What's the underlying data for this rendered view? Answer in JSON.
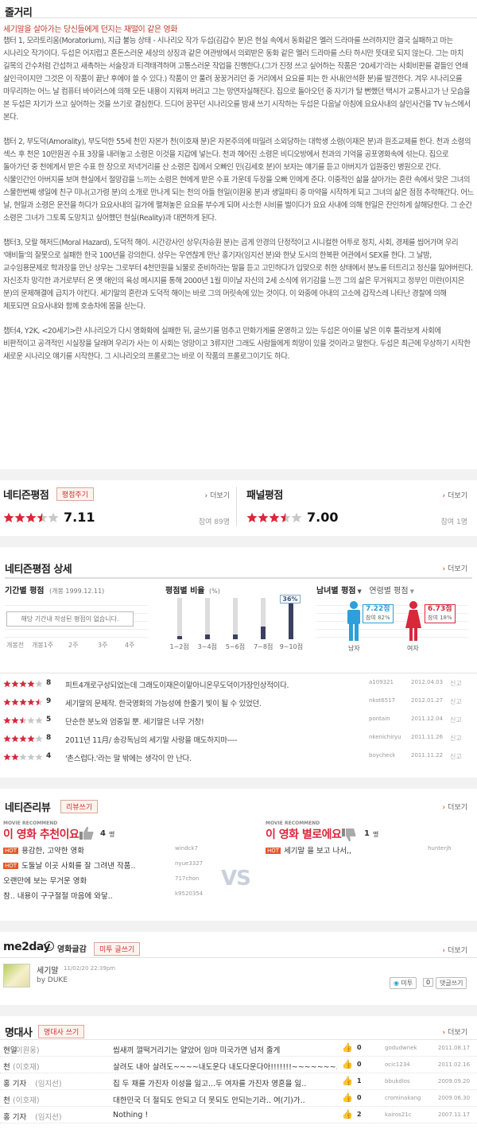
{
  "synopsis": {
    "title": "줄거리",
    "tagline": "세기말을 살아가는 당신들에게 던지는 재떨이 같은 영화",
    "paragraphs": [
      "챕터 1, 모라토리움(Moratorium), 지급 불능 상태 - 시나리오 작가 두섭(김갑수 분)은 현실 속에서 동화같은 멜러 드라마를 쓰려하지만 결국 실패하고 마는 시나리오 작가이다. 두섭은 어지럽고 혼돈스러운 세상의 상징과 같은 여관방에서 의뢰받은 동화 같은 멜러 드라마를 스타 하시만 뜻대로 되지 않는다. 그는 마치 길목의 간수처럼 간섭하고 새촉하는 서술장과 티격태격하며 고통스러운 작업을 진행한다.(그가 진정 쓰고 싶어하는 작품은 '20세기'라는 사회비판를 곁들인 연쇄 살인극이지만 그것은 이 작품이 끝난 후에야 쓸 수 있다.) 작품이 안 풀려 꿍꿍거리던 중 거리에서 요요를 피는 한 사내(안석환 분)를 발견한다. 겨우 시나리오를 마무리하는 어느 날 컴퓨터 바이러스에 의해 모든 내용이 지워져 버리고 그는 망연자실해진다. 집으로 돌아오던 중 자기가 탈 뻔했던 택시가 교통사고가 난 모습을 본 두섭은 자기가 쓰고 싶어하는 것을 쓰기로 결심한다. 드디어 꿈꾸던 시나리오를 밤새 쓰기 시작하는 두섭은 다음날 아침에 요요사내의 살인사건을 TV 뉴스에서 본다.",
      "챕터 2, 부도덕(Amorality), 부도덕한 55세 천민 자본가 천(이호재 분)은 자본주의에 떠밀려 소외당하는 대학생 소령(이재은 분)과 원조교제를 한다. 천과 소령의 섹스 후 천은 10만원권 수표 3장을 내려놓고 소령은 이것을 지갑에 넣는다. 천과 헤어진 소령은 비디오방에서 천과의 기억을 공포영화속에 섞는다. 집으로 돌아가던 중 천에게서 받은 수표 한 장으로 저녁거리를 산 소령은 집에서 오빠인 민(김세호 분)이 보자는 얘기를 듣고 아버지가 입원중인 병원으로 간다. 식물인간인 아버지를 보며 현실에서 절망감을 느끼는 소령은 현에게 받은 수표 가운데 두장을 오빠 민에게 준다. 이중적인 삶을 살아가는 혼란 속에서 맞은 그녀의 스물한번째 생일에 친구 미나(고가령 분)의 소개로 만나게 되는 천의 아들 현일(이원웅 분)과 생일파티 중 마약을 시작하게 되고 그녀의 삶은 점점 추락해간다. 어느 날, 현일과 소령은 운전을 하다가 요요사내의 길가에 펼쳐놓은 요요를 부수게 되며 사소한 시비를 벌이다가 요요 사내에 의해 현일은 잔인하게 살해당한다. 그 순간 소령은 그녀가 그토록 도망치고 싶어했던 현실(Reality)과 대면하게 된다.",
      "챕터3, 모랄 해저드(Moral Hazard), 도덕적 해이. 시간강사인 상우(차승원 분)는 곱게 안경의 단정적이고 시니컬한 어투로 정치, 사회, 경제를 씹어가며 우리 '애비들'의 잘못으로 실패한 한국 100년을 강의한다. 상우는 우연찮게 만난 홍기자(임지선 분)와 한낮 도시의 한복판 여관에서 SEX를 한다. 그 날밤, 교수임용문제로 학과장을 만난 상우는 그로부터 4천만원을 뇌물로 준비하라는 말을 듣고 고민하다가 입맞으로 취한 상태에서 분노를 터트리고 정신을 잃어버린다. 자신조차 망각한 과거로부터 온 옛 애인의 육성 메시지를 통해 2000년 1월 미이날 자신의 2세 소식에 위기감을 느낀 그의 삶은 무거워지고 정부인 미란(이지은 분)의 문제해결에 급치가 야킨다. 세기말의 혼란과 도덕적 해이는 바로 그의 머릿속에 있는 것이다. 이 와중에 아내의 고소에 갑작스레 나타난 경찰에 의해 체포되면 요요사내와 함께 호송차에 몸을 싣는다.",
      "챕터4, Y2K, <20세기>란 시나리오가 다시 영화화에 실패한 뒤, 글쓰기를 멈추고 만화가게를 운영하고 있는 두섭은 아이를 낳은 이후 틀라보게 사회에 비판적이고 공격적인 시실장을 달래며 우리가 사는 이 사회는 엉망이고 3류지만 그래도 사람들에게 희망이 있을 것이라고 말한다. 두섭은 최근에 무상하기 시작한 새로운 시나리오 얘기를 시작한다. 그 시나리오의 프롤로그는 바로 이 작품의 프롤로그이기도 하다."
    ]
  },
  "ratings": {
    "netizen": {
      "title": "네티즌평점",
      "button": "평점주기",
      "score": "7.11",
      "stars": 3.5,
      "participants": "참여 89명",
      "more": "더보기"
    },
    "panel": {
      "title": "패널평점",
      "score": "7.00",
      "stars": 3.5,
      "participants": "참여 1명",
      "more": "더보기"
    }
  },
  "detail": {
    "title": "네티즌평점 상세",
    "more": "더보기",
    "period": {
      "label": "기간별 평점",
      "sub": "(개봉 1999.12.11)",
      "empty": "해당 기간내 작성된 평점이 없습니다.",
      "ticks": [
        "개봉전",
        "개봉1주",
        "2주",
        "3주",
        "4주"
      ]
    },
    "dist": {
      "label": "평점별 비율",
      "unit": "(%)",
      "highlight": "36%",
      "bins": [
        "1~2점",
        "3~4점",
        "5~6점",
        "7~8점",
        "9~10점"
      ],
      "values": [
        3,
        5,
        5,
        12,
        36
      ]
    },
    "gender": {
      "label": "남녀별 평점",
      "age_label": "연령별 평점",
      "male": {
        "score": "7.22점",
        "share": "참여 82%",
        "label": "남자"
      },
      "female": {
        "score": "6.73점",
        "share": "참여 18%",
        "label": "여자"
      }
    }
  },
  "comments": [
    {
      "stars": 4,
      "score": "8",
      "text": "피트4개로구성되었는데 그래도이재은이맡아니온무도덕이가장인상적이다.",
      "user": "a109321",
      "date": "2012.04.03",
      "report": "신고"
    },
    {
      "stars": 4.5,
      "score": "9",
      "text": "세기말의 문제작. 한국영화의 가능성에 한줄기 빛이 될 수 있었던.",
      "user": "nkot6517",
      "date": "2012.01.27",
      "report": "신고"
    },
    {
      "stars": 2.5,
      "score": "5",
      "text": "단순한 분노와 엄중일 뿐. 세기말은 너무 거창!",
      "user": "pontain",
      "date": "2011.12.04",
      "report": "신고"
    },
    {
      "stars": 4,
      "score": "8",
      "text": "2011년 11月/ 송강독님의 세기말 사랑을 매도하지마----",
      "user": "nkenichiryu",
      "date": "2011.11.26",
      "report": "신고"
    },
    {
      "stars": 2,
      "score": "4",
      "text": "'촌스럽다.'라는 말 밖에는 생각이 안 난다.",
      "user": "boycheck",
      "date": "2011.11.22",
      "report": "신고"
    }
  ],
  "reviews": {
    "title": "네티즌리뷰",
    "button": "리뷰쓰기",
    "more": "더보기",
    "recommend_tag": "MOVIE RECOMMEND",
    "good": {
      "title": "이 영화 추천이요",
      "count": "4",
      "unit": "명",
      "items": [
        {
          "hot": true,
          "text": "용감한, 고약한 영화",
          "user": "windck7"
        },
        {
          "hot": true,
          "text": "도둘날 이곳 사회를 잘 그려낸 작품..",
          "user": "nyue3327"
        },
        {
          "hot": false,
          "text": "오랜만에 보는 무거운 영화",
          "user": "717chon"
        },
        {
          "hot": false,
          "text": "참.. 내용이 구구절절 마음에 와닿..",
          "user": "k9520354"
        }
      ]
    },
    "vs": "VS",
    "bad": {
      "title": "이 영화 별로에요",
      "count": "1",
      "unit": "명",
      "items": [
        {
          "hot": true,
          "text": "세기말 을 보고 나서,,",
          "user": "hunterjh"
        }
      ]
    }
  },
  "me2day": {
    "title": "me2day",
    "sub": "영화글감",
    "button": "미투 글쓰기",
    "more": "더보기",
    "post": {
      "text": "세기말",
      "time": "11/02/20 22:39pm",
      "by": "by DUKE"
    },
    "metoo": "미투",
    "metoo_count": "0",
    "reply": "댓글쓰기"
  },
  "quotes": {
    "title": "명대사",
    "button": "명대사 쓰기",
    "more": "더보기",
    "items": [
      {
        "char": "현일",
        "actor": "(이원웅)",
        "text": "씹새끼 껄떡거리기는 얄았어 임마 미국가면 넘저 줄게",
        "likes": "0",
        "user": "godudwnek",
        "date": "2011.08.17"
      },
      {
        "char": "천",
        "actor": "(이호재)",
        "text": "살려도 내아 살려도~~~~내도운다 내도다운다아!!!!!!!~~~~~~~..",
        "likes": "0",
        "user": "ocic1234",
        "date": "2011.02.16"
      },
      {
        "char": "홍 기자",
        "actor": "(임지선)",
        "text": "집 두 채를 가진자 이성을 잃고...두 여자를 가진자 영혼을 잃..",
        "likes": "1",
        "user": "bbukdlos",
        "date": "2009.09.20"
      },
      {
        "char": "천",
        "actor": "(이호재)",
        "text": "대한민국 더 절되도 안되고 더 못되도 안되는기라.. 여(기)가..",
        "likes": "0",
        "user": "crominakang",
        "date": "2009.06.30"
      },
      {
        "char": "홍 기자",
        "actor": "(임지선)",
        "text": "Nothing !",
        "likes": "2",
        "user": "kairos21c",
        "date": "2007.11.17"
      }
    ]
  }
}
